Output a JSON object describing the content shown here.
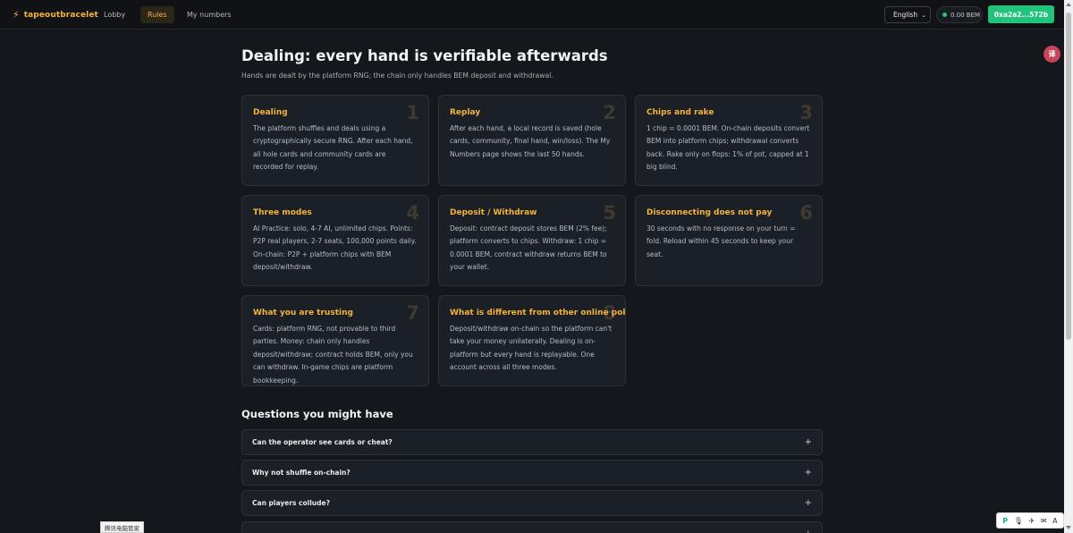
{
  "header": {
    "brand": "tapeoutbracelet",
    "nav": [
      "Lobby",
      "Rules",
      "My numbers"
    ],
    "active_nav": "Rules",
    "language": "English",
    "balance": "0.00 BEM",
    "wallet": "0xa2a2...572b",
    "brand_color": "#f5b33a",
    "accent_color": "#21c27a"
  },
  "page": {
    "title": "Dealing: every hand is verifiable afterwards",
    "subtitle": "Hands are dealt by the platform RNG; the chain only handles BEM deposit and withdrawal."
  },
  "cards": [
    {
      "num": "1",
      "title": "Dealing",
      "body": "The platform shuffles and deals using a cryptographically secure RNG. After each hand, all hole cards and community cards are recorded for replay."
    },
    {
      "num": "2",
      "title": "Replay",
      "body": "After each hand, a local record is saved (hole cards, community, final hand, win/loss). The My Numbers page shows the last 50 hands."
    },
    {
      "num": "3",
      "title": "Chips and rake",
      "body": "1 chip = 0.0001 BEM. On-chain deposits convert BEM into platform chips; withdrawal converts back. Rake only on flops: 1% of pot, capped at 1 big blind."
    },
    {
      "num": "4",
      "title": "Three modes",
      "body": "AI Practice: solo, 4-7 AI, unlimited chips. Points: P2P real players, 2-7 seats, 100,000 points daily. On-chain: P2P + platform chips with BEM deposit/withdraw."
    },
    {
      "num": "5",
      "title": "Deposit / Withdraw",
      "body": "Deposit: contract deposit stores BEM (2% fee); platform converts to chips. Withdraw: 1 chip = 0.0001 BEM, contract withdraw returns BEM to your wallet."
    },
    {
      "num": "6",
      "title": "Disconnecting does not pay",
      "body": "30 seconds with no response on your turn = fold. Reload within 45 seconds to keep your seat."
    },
    {
      "num": "7",
      "title": "What you are trusting",
      "body": "Cards: platform RNG, not provable to third parties. Money: chain only handles deposit/withdraw; contract holds BEM, only you can withdraw. In-game chips are platform bookkeeping."
    },
    {
      "num": "8",
      "title": "What is different from other online poker",
      "body": "Deposit/withdraw on-chain so the platform can't take your money unilaterally. Dealing is on-platform but every hand is replayable. One account across all three modes."
    }
  ],
  "faq": {
    "heading": "Questions you might have",
    "items": [
      {
        "q": "Can the operator see cards or cheat?",
        "icon": "+"
      },
      {
        "q": "Why not shuffle on-chain?",
        "icon": "+"
      },
      {
        "q": "Can players collude?",
        "icon": "+"
      },
      {
        "q": "",
        "icon": "+"
      }
    ]
  },
  "overlays": {
    "translate_label": "译",
    "tray_label": "腾讯电脑管家",
    "tray_icons": [
      "P",
      "🎙",
      "✈",
      "✉",
      "A"
    ]
  }
}
